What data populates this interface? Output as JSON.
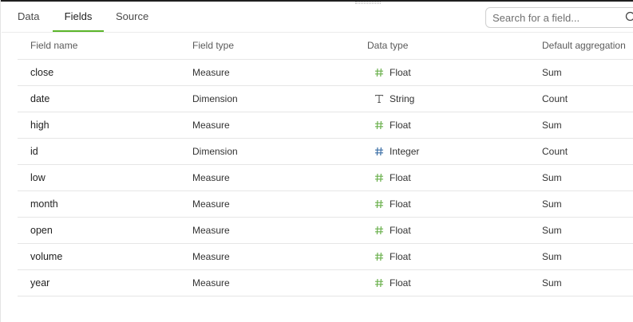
{
  "tabs": [
    {
      "label": "Data",
      "active": false
    },
    {
      "label": "Fields",
      "active": true
    },
    {
      "label": "Source",
      "active": false
    }
  ],
  "search": {
    "placeholder": "Search for a field..."
  },
  "colors": {
    "accent": "#5bb52a",
    "float_icon": "#6ab04c",
    "integer_icon": "#3a6ea5",
    "string_icon": "#555555"
  },
  "table": {
    "columns": [
      "Field name",
      "Field type",
      "Data type",
      "Default aggregation"
    ],
    "rows": [
      {
        "name": "close",
        "field_type": "Measure",
        "data_type": "Float",
        "data_icon": "hash-icon",
        "aggregation": "Sum"
      },
      {
        "name": "date",
        "field_type": "Dimension",
        "data_type": "String",
        "data_icon": "text-T-icon",
        "aggregation": "Count"
      },
      {
        "name": "high",
        "field_type": "Measure",
        "data_type": "Float",
        "data_icon": "hash-icon",
        "aggregation": "Sum"
      },
      {
        "name": "id",
        "field_type": "Dimension",
        "data_type": "Integer",
        "data_icon": "hash-icon",
        "aggregation": "Count"
      },
      {
        "name": "low",
        "field_type": "Measure",
        "data_type": "Float",
        "data_icon": "hash-icon",
        "aggregation": "Sum"
      },
      {
        "name": "month",
        "field_type": "Measure",
        "data_type": "Float",
        "data_icon": "hash-icon",
        "aggregation": "Sum"
      },
      {
        "name": "open",
        "field_type": "Measure",
        "data_type": "Float",
        "data_icon": "hash-icon",
        "aggregation": "Sum"
      },
      {
        "name": "volume",
        "field_type": "Measure",
        "data_type": "Float",
        "data_icon": "hash-icon",
        "aggregation": "Sum"
      },
      {
        "name": "year",
        "field_type": "Measure",
        "data_type": "Float",
        "data_icon": "hash-icon",
        "aggregation": "Sum"
      }
    ]
  }
}
